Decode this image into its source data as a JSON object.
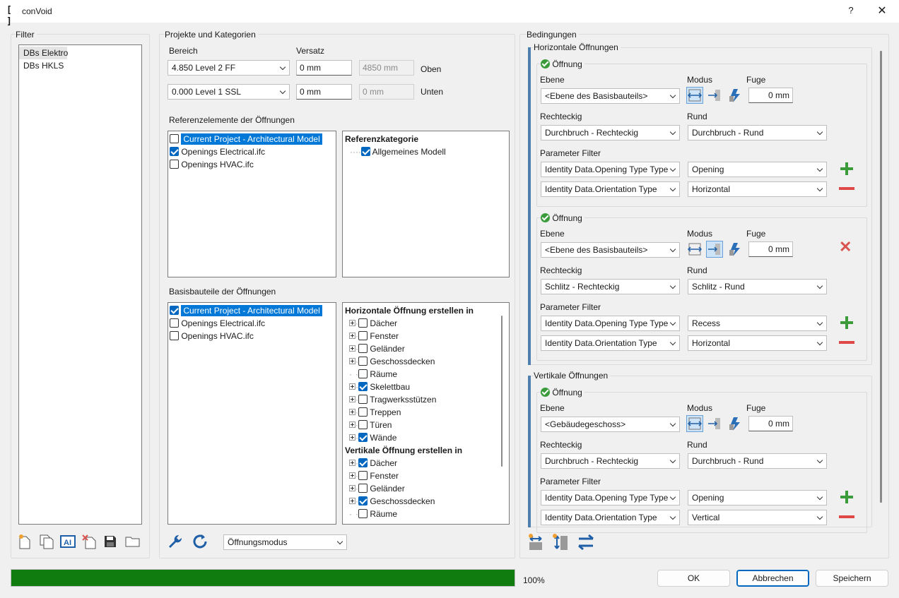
{
  "window": {
    "app_icon": "[ ]",
    "title": "conVoid",
    "help": "?",
    "close": "✕"
  },
  "filter": {
    "label": "Filter",
    "items": [
      "DBs Elektro",
      "DBs HKLS"
    ],
    "toolbar": [
      "new-filter-icon",
      "copy-filter-icon",
      "rename-filter-icon",
      "delete-filter-icon",
      "save-filter-icon",
      "open-folder-icon"
    ]
  },
  "projekte": {
    "label": "Projekte und Kategorien",
    "bereich_label": "Bereich",
    "versatz_label": "Versatz",
    "rows": [
      {
        "level": "4.850  Level 2 FF",
        "offset": "0 mm",
        "computed": "4850 mm",
        "pos": "Oben"
      },
      {
        "level": "0.000  Level 1 SSL",
        "offset": "0 mm",
        "computed": "0 mm",
        "pos": "Unten"
      }
    ],
    "ref_label": "Referenzelemente der Öffnungen",
    "ref_models": [
      {
        "name": "Current Project - Architectural Model",
        "checked": false,
        "selected": true
      },
      {
        "name": "Openings Electrical.ifc",
        "checked": true,
        "selected": false
      },
      {
        "name": "Openings HVAC.ifc",
        "checked": false,
        "selected": false
      }
    ],
    "ref_cat_title": "Referenzkategorie",
    "ref_cat_item": "Allgemeines Modell",
    "base_label": "Basisbauteile der Öffnungen",
    "base_models": [
      {
        "name": "Current Project - Architectural Model",
        "checked": true,
        "selected": true
      },
      {
        "name": "Openings Electrical.ifc",
        "checked": false,
        "selected": false
      },
      {
        "name": "Openings HVAC.ifc",
        "checked": false,
        "selected": false
      }
    ],
    "horiz_title": "Horizontale Öffnung erstellen in",
    "horiz_items": [
      {
        "n": "Dächer",
        "c": false,
        "e": true
      },
      {
        "n": "Fenster",
        "c": false,
        "e": true
      },
      {
        "n": "Geländer",
        "c": false,
        "e": true
      },
      {
        "n": "Geschossdecken",
        "c": false,
        "e": true
      },
      {
        "n": "Räume",
        "c": false,
        "e": false
      },
      {
        "n": "Skelettbau",
        "c": true,
        "e": true
      },
      {
        "n": "Tragwerksstützen",
        "c": false,
        "e": true
      },
      {
        "n": "Treppen",
        "c": false,
        "e": true
      },
      {
        "n": "Türen",
        "c": false,
        "e": true
      },
      {
        "n": "Wände",
        "c": true,
        "e": true
      }
    ],
    "vert_title": "Vertikale Öffnung erstellen in",
    "vert_items": [
      {
        "n": "Dächer",
        "c": true,
        "e": true
      },
      {
        "n": "Fenster",
        "c": false,
        "e": true
      },
      {
        "n": "Geländer",
        "c": false,
        "e": true
      },
      {
        "n": "Geschossdecken",
        "c": true,
        "e": true
      },
      {
        "n": "Räume",
        "c": false,
        "e": false
      }
    ],
    "mode_combo": "Öffnungsmodus"
  },
  "bedingungen": {
    "label": "Bedingungen",
    "horiz_label": "Horizontale Öffnungen",
    "vert_label": "Vertikale Öffnungen",
    "oeffnung": "Öffnung",
    "ebene": "Ebene",
    "modus": "Modus",
    "fuge": "Fuge",
    "rechteckig": "Rechteckig",
    "rund": "Rund",
    "param": "Parameter Filter",
    "h1": {
      "ebene": "<Ebene des Basisbauteils>",
      "fuge": "0 mm",
      "rect": "Durchbruch - Rechteckig",
      "rund": "Durchbruch - Rund",
      "p1": "Identity Data.Opening Type Type",
      "v1": "Opening",
      "p2": "Identity Data.Orientation Type",
      "v2": "Horizontal"
    },
    "h2": {
      "ebene": "<Ebene des Basisbauteils>",
      "fuge": "0 mm",
      "rect": "Schlitz - Rechteckig",
      "rund": "Schlitz - Rund",
      "p1": "Identity Data.Opening Type Type",
      "v1": "Recess",
      "p2": "Identity Data.Orientation Type",
      "v2": "Horizontal"
    },
    "v1": {
      "ebene": "<Gebäudegeschoss>",
      "fuge": "0 mm",
      "rect": "Durchbruch - Rechteckig",
      "rund": "Durchbruch - Rund",
      "p1": "Identity Data.Opening Type Type",
      "v1": "Opening",
      "p2": "Identity Data.Orientation Type",
      "v2": "Vertical"
    }
  },
  "bottom": {
    "progress": 1.0,
    "progress_text": "100%",
    "ok": "OK",
    "cancel": "Abbrechen",
    "save": "Speichern",
    "progress_color": "#107c10"
  }
}
